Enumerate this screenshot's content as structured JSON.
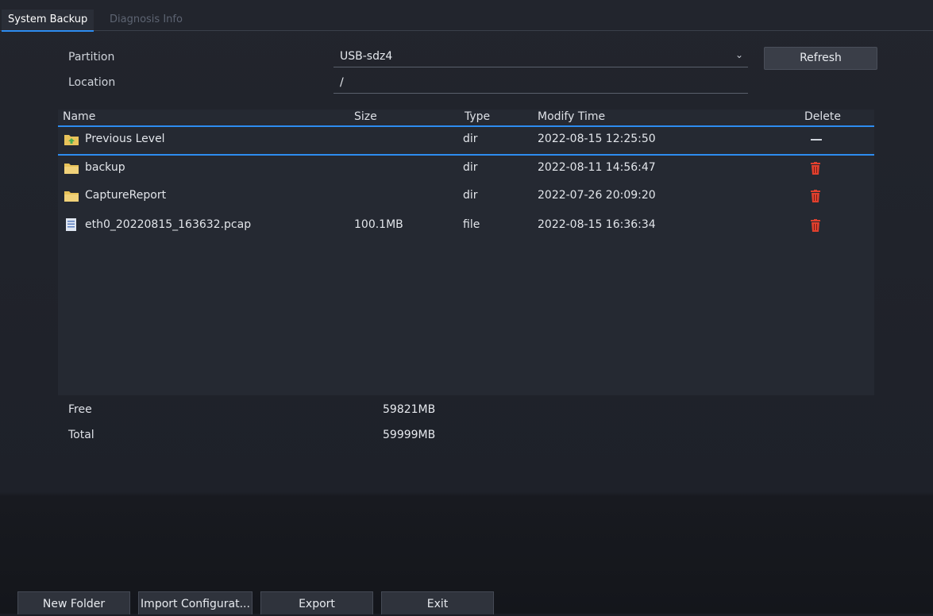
{
  "tabs": [
    {
      "label": "System Backup",
      "active": true
    },
    {
      "label": "Diagnosis Info",
      "active": false
    }
  ],
  "form": {
    "partition_label": "Partition",
    "partition_value": "USB-sdz4",
    "location_label": "Location",
    "location_value": "/",
    "refresh_label": "Refresh"
  },
  "table": {
    "headers": {
      "name": "Name",
      "size": "Size",
      "type": "Type",
      "modify_time": "Modify Time",
      "delete": "Delete"
    },
    "rows": [
      {
        "name": "Previous Level",
        "size": "",
        "type": "dir",
        "modify_time": "2022-08-15 12:25:50",
        "icon": "up-folder-icon"
      },
      {
        "name": "backup",
        "size": "",
        "type": "dir",
        "modify_time": "2022-08-11 14:56:47",
        "icon": "folder-icon"
      },
      {
        "name": "CaptureReport",
        "size": "",
        "type": "dir",
        "modify_time": "2022-07-26 20:09:20",
        "icon": "folder-icon"
      },
      {
        "name": "eth0_20220815_163632.pcap",
        "size": "100.1MB",
        "type": "file",
        "modify_time": "2022-08-15 16:36:34",
        "icon": "file-icon"
      }
    ]
  },
  "storage": {
    "free_label": "Free",
    "free_value": "59821MB",
    "total_label": "Total",
    "total_value": "59999MB"
  },
  "buttons": {
    "new_folder": "New Folder",
    "import_config": "Import Configurat...",
    "export": "Export",
    "exit": "Exit"
  },
  "colors": {
    "accent": "#2d8cf0",
    "folder": "#e8c35a",
    "trash": "#e0402e"
  }
}
